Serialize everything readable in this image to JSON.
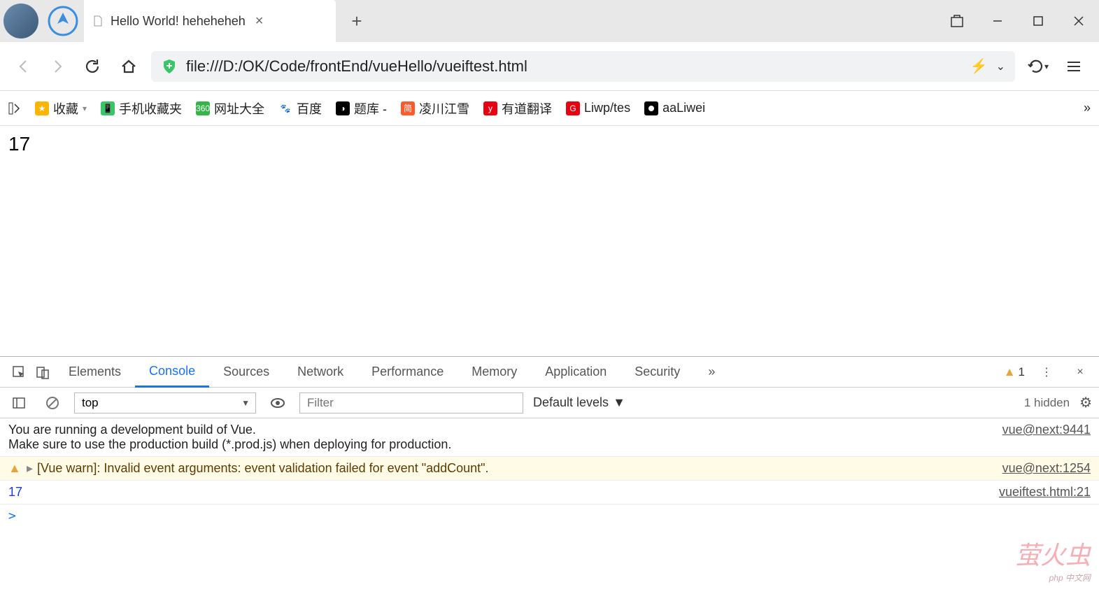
{
  "tab": {
    "title": "Hello World! heheheheh"
  },
  "url": "file:///D:/OK/Code/frontEnd/vueHello/vueiftest.html",
  "bookmarks": [
    {
      "label": "收藏",
      "icon_bg": "#ffb400",
      "glyph": "★"
    },
    {
      "label": "手机收藏夹",
      "icon_bg": "#3ac569",
      "glyph": "📱"
    },
    {
      "label": "网址大全",
      "icon_bg": "#35b44a",
      "glyph": "360"
    },
    {
      "label": "百度",
      "icon_bg": "#fff",
      "glyph": "🐾"
    },
    {
      "label": "题库 -",
      "icon_bg": "#000",
      "glyph": "◑"
    },
    {
      "label": "凌川江雪",
      "icon_bg": "#ff5a2b",
      "glyph": "简"
    },
    {
      "label": "有道翻译",
      "icon_bg": "#e60012",
      "glyph": "y"
    },
    {
      "label": "Liwp/tes",
      "icon_bg": "#e60012",
      "glyph": "G"
    },
    {
      "label": "aaLiwei",
      "icon_bg": "#000",
      "glyph": ""
    }
  ],
  "page": {
    "content": "17"
  },
  "devtools": {
    "tabs": [
      "Elements",
      "Console",
      "Sources",
      "Network",
      "Performance",
      "Memory",
      "Application",
      "Security"
    ],
    "active_tab": "Console",
    "overflow": "»",
    "warn_count": "1",
    "context": "top",
    "filter_placeholder": "Filter",
    "levels": "Default levels",
    "hidden": "1 hidden",
    "messages": [
      {
        "type": "info",
        "text": "You are running a development build of Vue.\nMake sure to use the production build (*.prod.js) when deploying for production.",
        "src": "vue@next:9441"
      },
      {
        "type": "warn",
        "text": "[Vue warn]: Invalid event arguments: event validation failed for event \"addCount\".",
        "src": "vue@next:1254"
      },
      {
        "type": "log",
        "text": "17",
        "src": "vueiftest.html:21"
      }
    ],
    "prompt": ">"
  },
  "watermark": {
    "main": "萤火虫",
    "sub": "php 中文网"
  }
}
